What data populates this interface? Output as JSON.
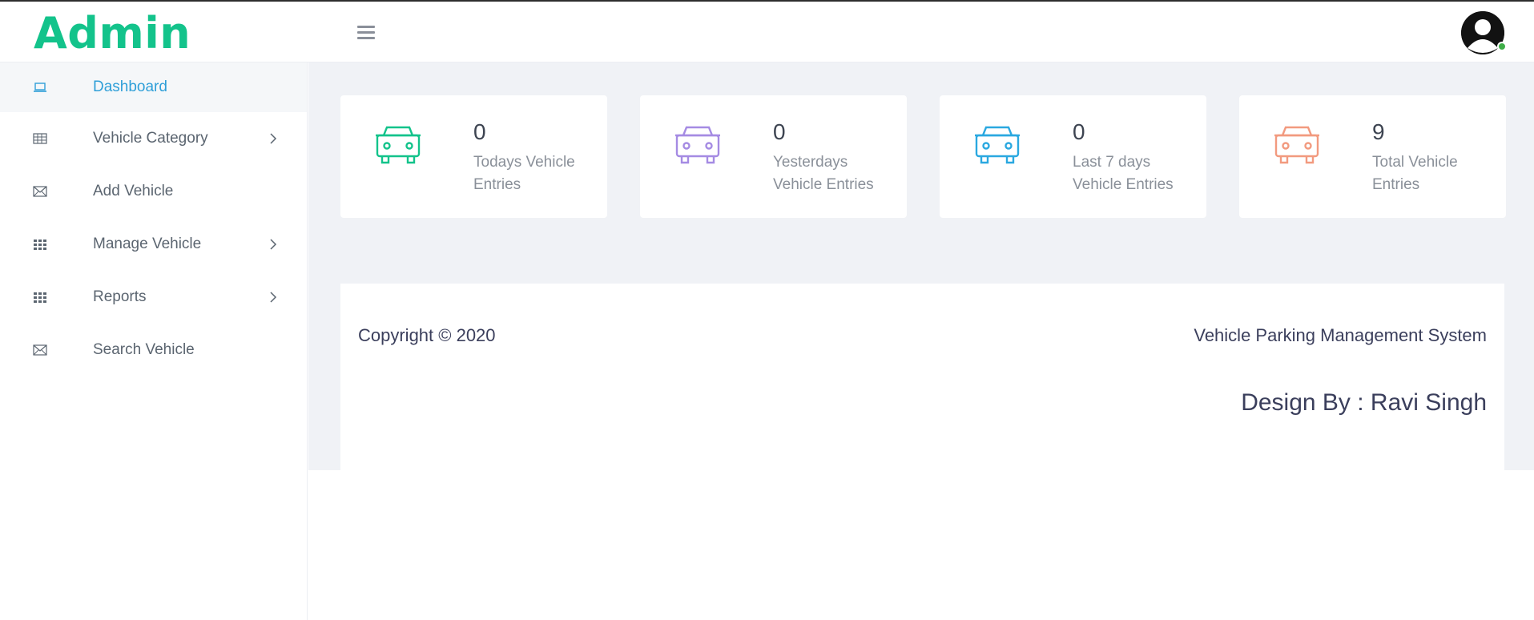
{
  "header": {
    "brand": "Admin",
    "menu_icon": "hamburger-icon",
    "avatar_icon": "user-avatar-icon",
    "status_color": "#3fae49"
  },
  "sidebar": {
    "items": [
      {
        "label": "Dashboard",
        "icon": "laptop-icon",
        "active": true,
        "has_submenu": false
      },
      {
        "label": "Vehicle Category",
        "icon": "table-icon",
        "active": false,
        "has_submenu": true
      },
      {
        "label": "Add Vehicle",
        "icon": "envelope-icon",
        "active": false,
        "has_submenu": false
      },
      {
        "label": "Manage Vehicle",
        "icon": "grid-icon",
        "active": false,
        "has_submenu": true
      },
      {
        "label": "Reports",
        "icon": "grid-icon",
        "active": false,
        "has_submenu": true
      },
      {
        "label": "Search Vehicle",
        "icon": "envelope-icon",
        "active": false,
        "has_submenu": false
      }
    ]
  },
  "stats": [
    {
      "value": "0",
      "label": "Todays Vehicle Entries",
      "color": "#13c38b",
      "icon": "car-icon"
    },
    {
      "value": "0",
      "label": "Yesterdays Vehicle Entries",
      "color": "#a58be3",
      "icon": "car-icon"
    },
    {
      "value": "0",
      "label": "Last 7 days Vehicle Entries",
      "color": "#2aa8e0",
      "icon": "car-icon"
    },
    {
      "value": "9",
      "label": "Total Vehicle Entries",
      "color": "#f29a7f",
      "icon": "car-icon"
    }
  ],
  "footer": {
    "copyright": "Copyright © 2020",
    "system_name": "Vehicle Parking Management System",
    "design_by": "Design By : Ravi Singh"
  },
  "colors": {
    "brand": "#13c38b",
    "active_nav": "#2f9fd8",
    "content_bg": "#f0f2f6"
  }
}
